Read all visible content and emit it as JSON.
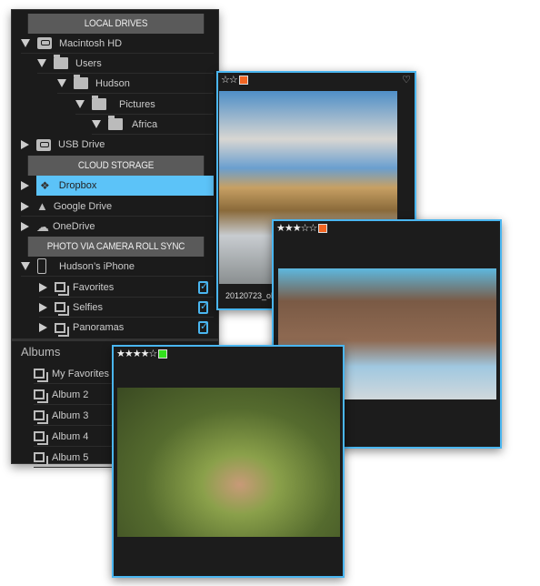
{
  "sidebar": {
    "local_drives_header": "LOCAL DRIVES",
    "local": [
      {
        "label": "Macintosh HD",
        "icon": "hard-drive-icon"
      },
      {
        "label": "Users",
        "icon": "folder-icon"
      },
      {
        "label": "Hudson",
        "icon": "folder-icon"
      },
      {
        "label": "Pictures",
        "icon": "folder-icon"
      },
      {
        "label": "Africa",
        "icon": "folder-icon"
      },
      {
        "label": "USB Drive",
        "icon": "hard-drive-icon"
      }
    ],
    "cloud_header": "CLOUD STORAGE",
    "cloud": [
      {
        "label": "Dropbox",
        "icon": "dropbox-icon",
        "selected": true
      },
      {
        "label": "Google Drive",
        "icon": "google-drive-icon"
      },
      {
        "label": "OneDrive",
        "icon": "onedrive-icon"
      }
    ],
    "camera_header": "PHOTO VIA CAMERA ROLL SYNC",
    "device": "Hudson’s iPhone",
    "camera": [
      {
        "label": "Favorites"
      },
      {
        "label": "Selfies"
      },
      {
        "label": "Panoramas"
      }
    ],
    "albums_title": "Albums",
    "albums": [
      "My Favorites",
      "Album 2",
      "Album 3",
      "Album 4",
      "Album 5"
    ]
  },
  "cards": [
    {
      "stars": "☆☆",
      "label_color": "#f26522",
      "caption": "20120723_oly",
      "heart": "♡"
    },
    {
      "stars": "★★★☆☆",
      "label_color": "#f26522"
    },
    {
      "stars": "★★★★☆",
      "label_color": "#33e01e"
    }
  ],
  "colors": {
    "accent": "#4ab6f0",
    "selection": "#5cc3f8"
  }
}
